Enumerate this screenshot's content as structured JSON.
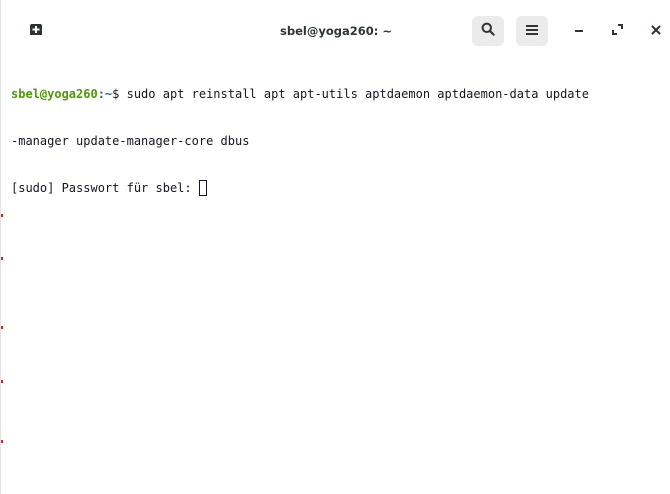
{
  "window": {
    "title": "sbel@yoga260: ~"
  },
  "header": {
    "new_tab_icon": "new-tab-icon",
    "search_icon": "search-icon",
    "menu_icon": "hamburger-menu-icon",
    "minimize_icon": "minimize-icon",
    "maximize_icon": "maximize-icon",
    "close_icon": "close-icon"
  },
  "terminal": {
    "prompt_user": "sbel@yoga260",
    "prompt_path": ":~",
    "prompt_symbol": "$ ",
    "command_line1": "sudo apt reinstall apt apt-utils aptdaemon aptdaemon-data update",
    "command_line2": "-manager update-manager-core dbus",
    "password_prompt": "[sudo] Passwort für sbel: "
  },
  "colors": {
    "prompt_user": "#4e9a06",
    "prompt_path": "#3465a4",
    "text": "#171421",
    "background": "#ffffff",
    "header_button": "#ebebeb"
  }
}
